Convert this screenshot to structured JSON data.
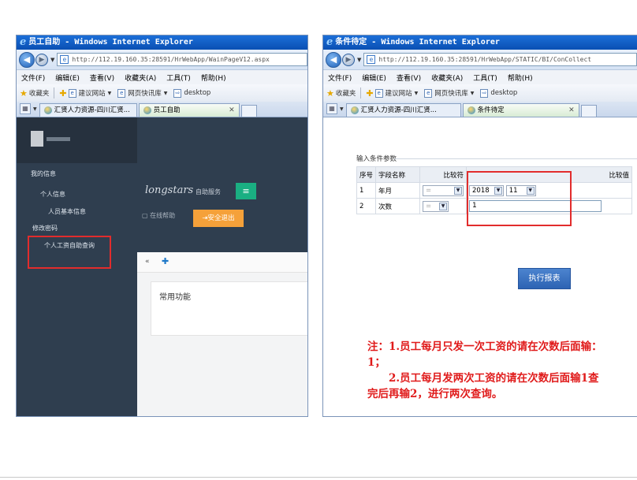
{
  "window_left": {
    "title": "员工自助 - Windows Internet Explorer",
    "address": "http://112.19.160.35:28591/HrWebApp/WainPageV12.aspx",
    "menu": [
      "文件(F)",
      "编辑(E)",
      "查看(V)",
      "收藏夹(A)",
      "工具(T)",
      "帮助(H)"
    ],
    "favorites": {
      "label": "收藏夹",
      "items": [
        "建议网站",
        "网页快讯库",
        "desktop"
      ]
    },
    "tabs": [
      "汇贤人力资源-四川汇贤...",
      "员工自助"
    ],
    "sidebar": {
      "my_info": "我的信息",
      "personal_info": "个人信息",
      "basic_info": "人员基本信息",
      "change_password": "修改密码",
      "salary_query": "个人工资自助查询"
    },
    "logo": "longstars",
    "logo_sub": "自助服务",
    "help": "在线帮助",
    "logout": "安全退出",
    "panel_title": "常用功能"
  },
  "window_right": {
    "title": "条件待定 - Windows Internet Explorer",
    "address": "http://112.19.160.35:28591/HrWebApp/STATIC/BI/ConCollect",
    "menu": [
      "文件(F)",
      "编辑(E)",
      "查看(V)",
      "收藏夹(A)",
      "工具(T)",
      "帮助(H)"
    ],
    "favorites": {
      "label": "收藏夹",
      "items": [
        "建议网站",
        "网页快讯库",
        "desktop"
      ]
    },
    "tabs": [
      "汇贤人力资源-四川汇贤...",
      "条件待定"
    ],
    "form": {
      "legend": "输入条件参数",
      "headers": [
        "序号",
        "字段名称",
        "比较符",
        "比较值"
      ],
      "rows": [
        {
          "no": "1",
          "field": "年月",
          "op": "=",
          "year": "2018",
          "month": "11"
        },
        {
          "no": "2",
          "field": "次数",
          "op": "=",
          "value": "1"
        }
      ],
      "run_button": "执行报表"
    },
    "note": [
      "注：1.员工每月只发一次工资的请在次数后面输：1；",
      "2.员工每月发两次工资的请在次数后面输1查完后再输2，进行两次查询。"
    ]
  }
}
